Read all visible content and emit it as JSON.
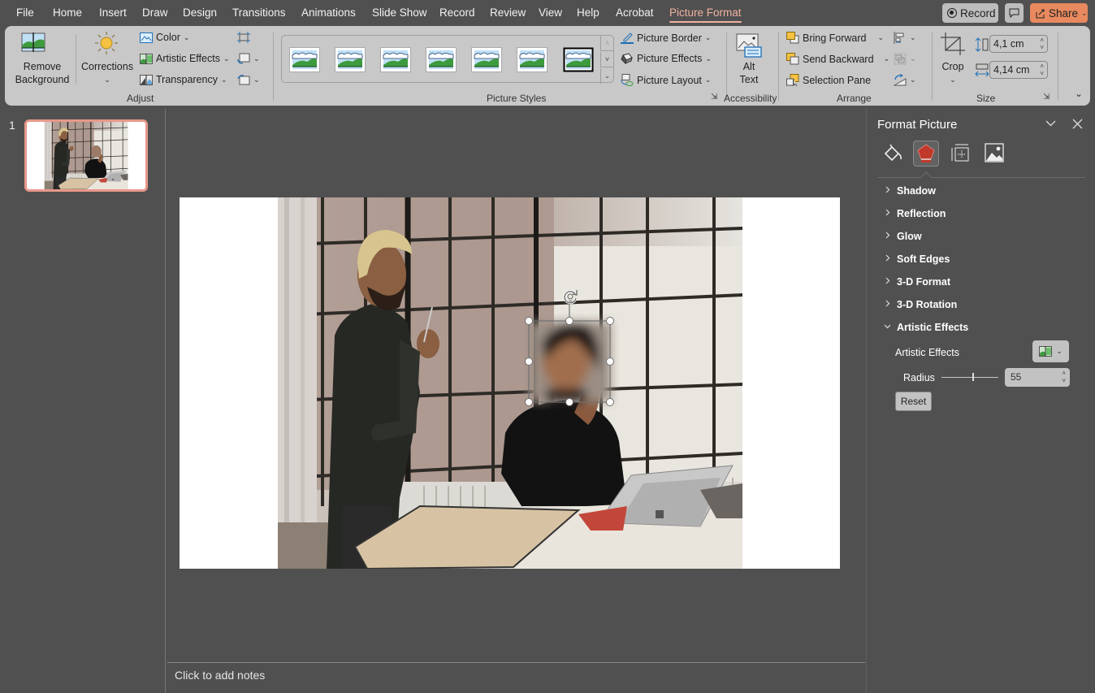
{
  "menu": {
    "tabs": [
      "File",
      "Home",
      "Insert",
      "Draw",
      "Design",
      "Transitions",
      "Animations",
      "Slide Show",
      "Record",
      "Review",
      "View",
      "Help",
      "Acrobat",
      "Picture Format"
    ],
    "active_tab": "Picture Format",
    "record_label": "Record",
    "share_label": "Share"
  },
  "ribbon": {
    "adjust": {
      "label": "Adjust",
      "remove_background": [
        "Remove",
        "Background"
      ],
      "corrections": "Corrections",
      "color": "Color",
      "artistic_effects": "Artistic Effects",
      "transparency": "Transparency"
    },
    "picture_styles": {
      "label": "Picture Styles",
      "gallery_count": 7,
      "picture_border": "Picture Border",
      "picture_effects": "Picture Effects",
      "picture_layout": "Picture Layout"
    },
    "accessibility": {
      "label": "Accessibility",
      "alt_text": [
        "Alt",
        "Text"
      ]
    },
    "arrange": {
      "label": "Arrange",
      "bring_forward": "Bring Forward",
      "send_backward": "Send Backward",
      "selection_pane": "Selection Pane"
    },
    "size": {
      "label": "Size",
      "crop": "Crop",
      "height": "4,1 cm",
      "width": "4,14 cm"
    }
  },
  "slides": {
    "current_number": "1"
  },
  "notes": {
    "placeholder": "Click to add notes"
  },
  "format_pane": {
    "title": "Format Picture",
    "tabs": [
      "fill-line-icon",
      "effects-icon",
      "size-properties-icon",
      "picture-icon"
    ],
    "active_tab": "effects-icon",
    "sections": [
      {
        "label": "Shadow",
        "expanded": false
      },
      {
        "label": "Reflection",
        "expanded": false
      },
      {
        "label": "Glow",
        "expanded": false
      },
      {
        "label": "Soft Edges",
        "expanded": false
      },
      {
        "label": "3-D Format",
        "expanded": false
      },
      {
        "label": "3-D Rotation",
        "expanded": false
      },
      {
        "label": "Artistic Effects",
        "expanded": true
      }
    ],
    "artistic_effects_label": "Artistic Effects",
    "radius_label": "Radius",
    "radius_value": "55",
    "radius_fraction": 0.55,
    "reset_label": "Reset"
  },
  "colors": {
    "accent": "#f0b2a0",
    "share": "#e8895f",
    "effects_active": "#c0392b",
    "thumb_border": "#e8988a"
  }
}
